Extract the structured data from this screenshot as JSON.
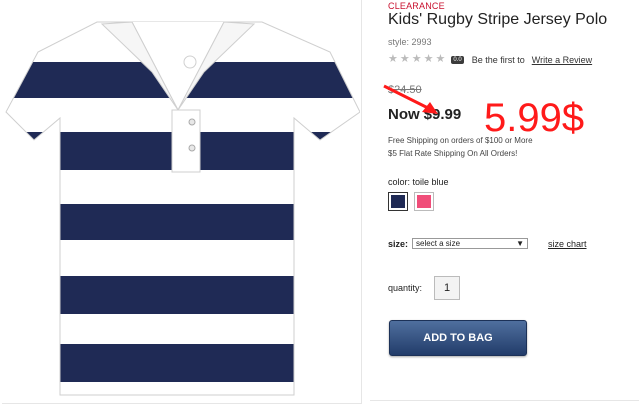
{
  "product": {
    "badge": "CLEARANCE",
    "title": "Kids' Rugby Stripe Jersey Polo",
    "style": "style: 2993",
    "rating": {
      "stars": 0,
      "score_text": "0.0",
      "prompt": "Be the first to",
      "link": "Write a Review"
    },
    "original_price": "$24.50",
    "now_label": "Now",
    "now_price": "$9.99",
    "shipping_line1": "Free Shipping on orders of $100 or More",
    "shipping_line2": "$5 Flat Rate Shipping On All Orders!",
    "color_label": "color: toile blue",
    "swatches": [
      {
        "name": "toile blue",
        "color": "#1f2a55"
      },
      {
        "name": "pink",
        "color": "#f04d79"
      }
    ],
    "size_label": "size:",
    "size_placeholder": "select a size",
    "size_chart": "size chart",
    "quantity_label": "quantity:",
    "quantity_value": "1",
    "add_button": "ADD TO BAG"
  },
  "annotation": {
    "text": "5.99$",
    "color": "#ff1a1a"
  },
  "colors": {
    "brand_red": "#c8102e",
    "navy": "#1f2a55",
    "button": "#2f4f82"
  }
}
